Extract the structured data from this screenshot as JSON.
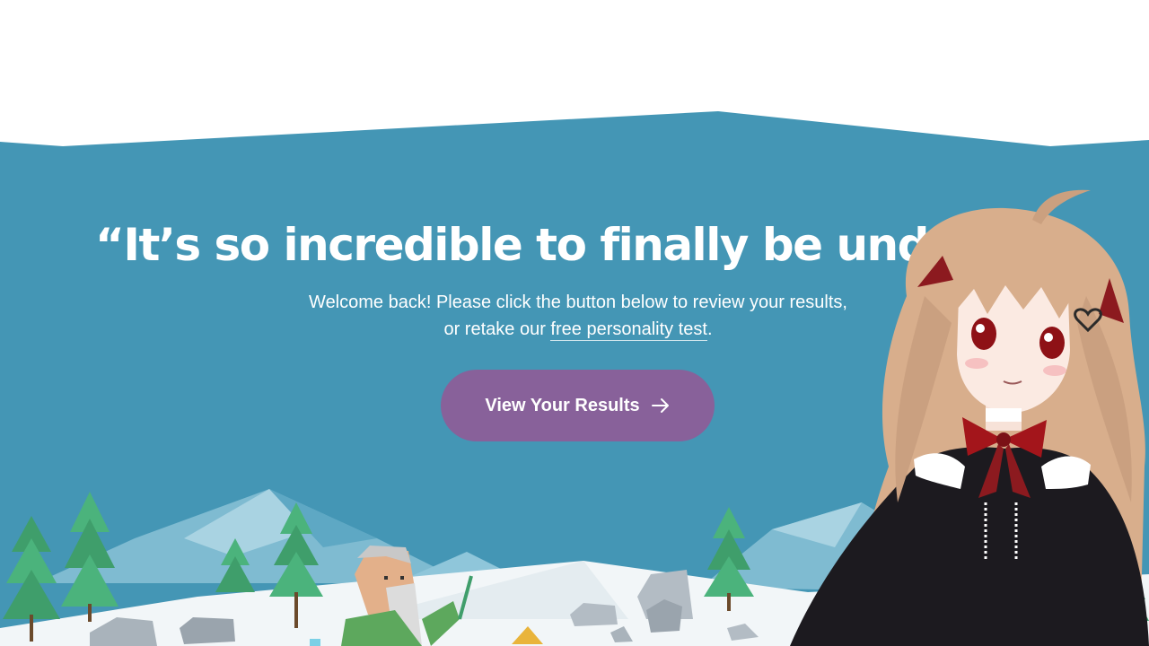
{
  "hero": {
    "headline": "“It’s so incredible to finally be underst",
    "subtext_line1": "Welcome back! Please click the button below to review your results,",
    "subtext_line2_prefix": "or retake our ",
    "subtext_link": "free personality test",
    "subtext_line2_suffix": ".",
    "cta_label": "View Your Results"
  },
  "colors": {
    "hero_bg": "#4496b5",
    "cta_bg": "#88619a",
    "text": "#ffffff"
  },
  "icons": {
    "cta_icon": "arrow-right-icon"
  }
}
